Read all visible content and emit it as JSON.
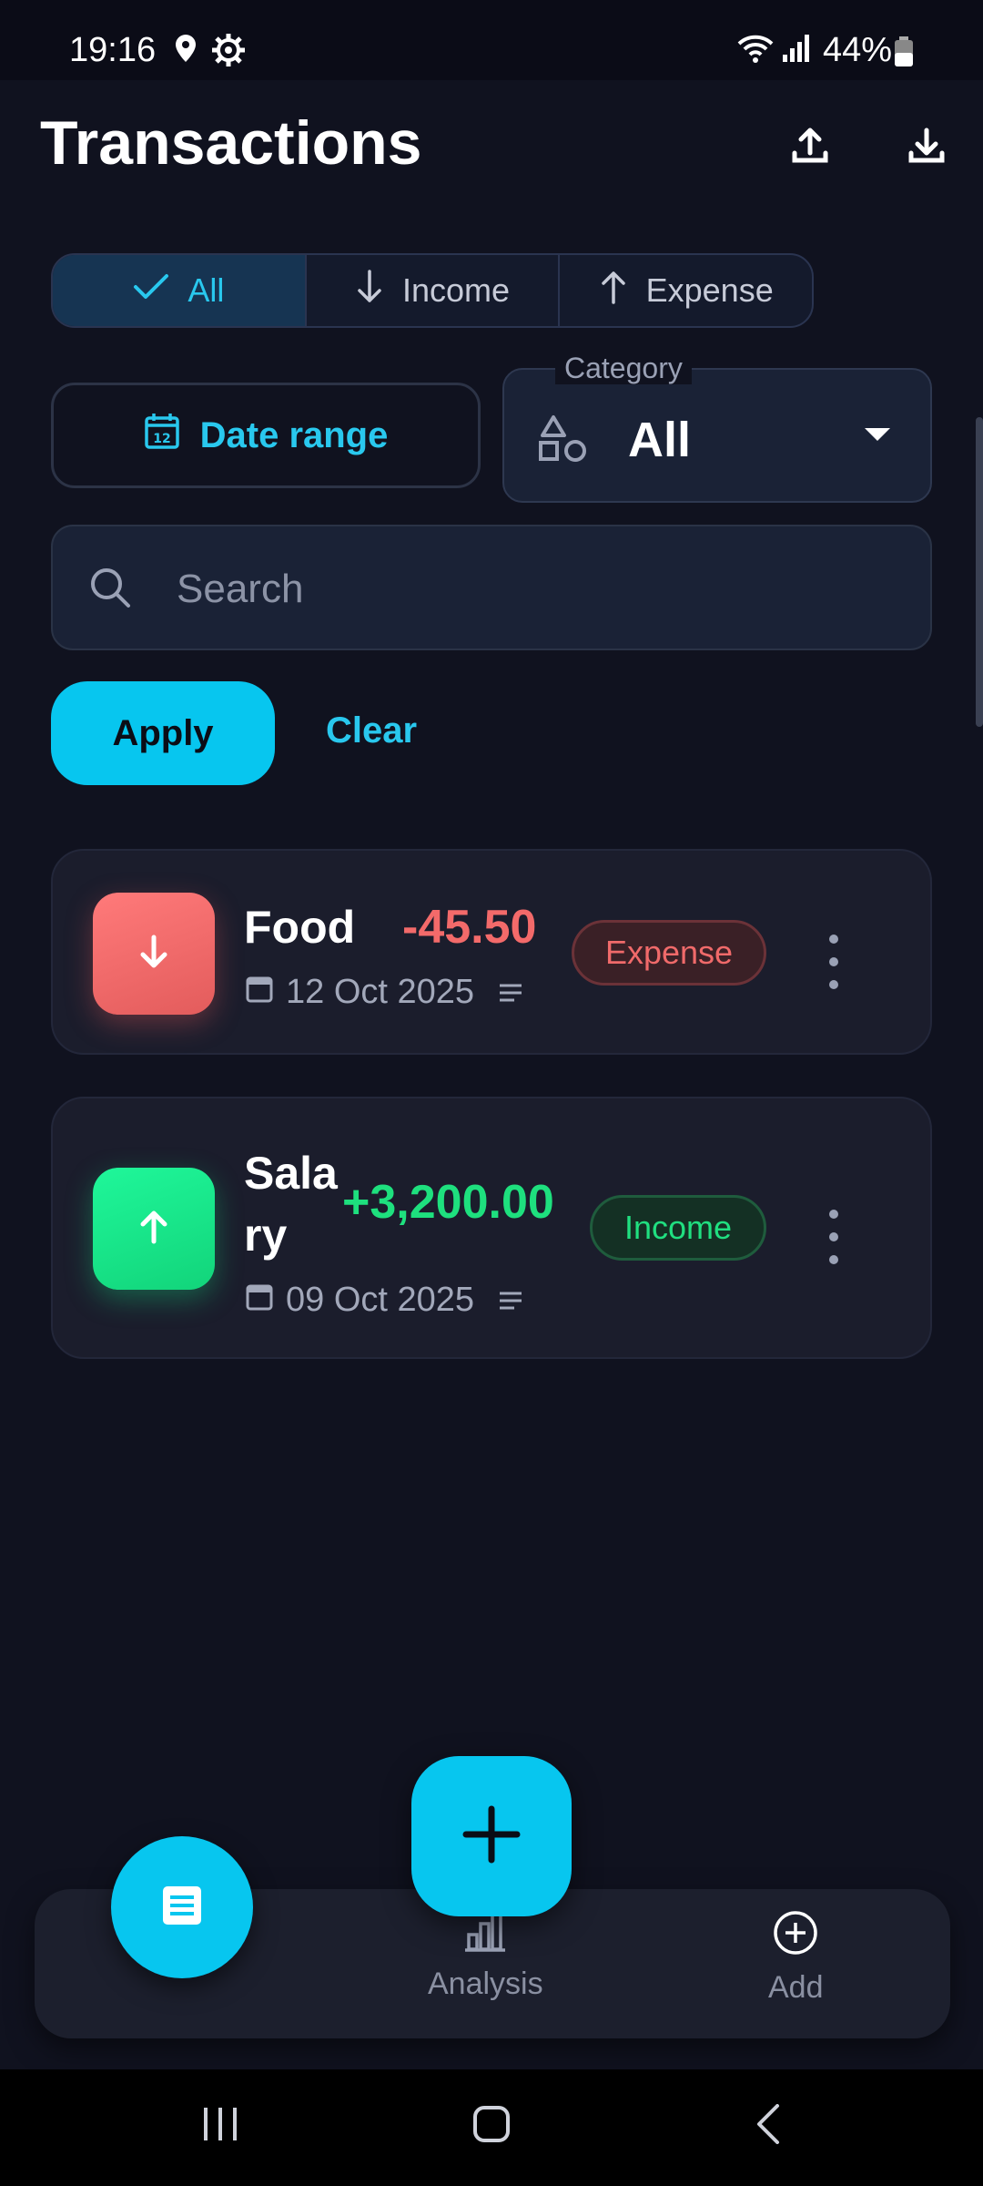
{
  "status_bar": {
    "time": "19:16",
    "battery": "44%"
  },
  "header": {
    "title": "Transactions",
    "export_icon": "upload-icon",
    "import_icon": "download-icon"
  },
  "filters": {
    "type_tabs": [
      {
        "label": "All",
        "icon": "check-icon",
        "selected": true
      },
      {
        "label": "Income",
        "icon": "arrow-down-icon",
        "selected": false
      },
      {
        "label": "Expense",
        "icon": "arrow-up-icon",
        "selected": false
      }
    ],
    "date_range_label": "Date range",
    "category_label": "Category",
    "category_value": "All",
    "search_placeholder": "Search",
    "search_value": "",
    "apply_label": "Apply",
    "clear_label": "Clear"
  },
  "transactions": [
    {
      "name": "Food",
      "amount": "-45.50",
      "date": "12 Oct 2025",
      "type_label": "Expense",
      "kind": "expense"
    },
    {
      "name": "Salary",
      "name_line1": "Sala",
      "name_line2": "ry",
      "amount": "+3,200.00",
      "date": "09 Oct 2025",
      "type_label": "Income",
      "kind": "income"
    }
  ],
  "bottom_nav": {
    "items": [
      {
        "label": "",
        "icon": "list-icon",
        "active": true
      },
      {
        "label": "Analysis",
        "icon": "bar-chart-icon",
        "active": false
      },
      {
        "label": "Add",
        "icon": "add-circle-icon",
        "active": false
      }
    ],
    "fab_icon": "plus-icon"
  },
  "colors": {
    "accent": "#07c6ef",
    "expense": "#f36a6a",
    "income": "#1ee07e",
    "background": "#10121f",
    "card": "#1b1d2c"
  }
}
